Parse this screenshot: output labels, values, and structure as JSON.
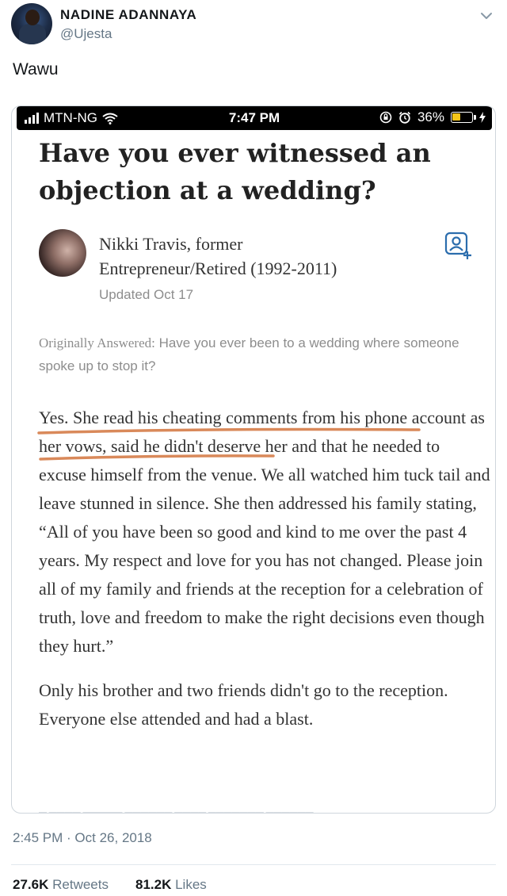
{
  "tweet": {
    "display_name": "NADINE ADANNAYA",
    "handle": "@Ujesta",
    "text": "Wawu",
    "timestamp": "2:45 PM · Oct 26, 2018",
    "retweets_count": "27.6K",
    "retweets_label": "Retweets",
    "likes_count": "81.2K",
    "likes_label": "Likes"
  },
  "screenshot": {
    "statusbar": {
      "carrier": "MTN-NG",
      "time": "7:47 PM",
      "battery": "36%"
    },
    "question_title": "Have you ever witnessed an objection at a wedding?",
    "author": {
      "line1": "Nikki Travis, former",
      "line2": "Entrepreneur/Retired (1992-2011)",
      "updated": "Updated Oct 17"
    },
    "originally_label": "Originally Answered:",
    "originally_question": "Have you ever been to a wedding where someone spoke up to stop it?",
    "answer_paragraph_1": "Yes. She read his cheating comments from his phone account as her vows, said he didn't deserve her and that he needed to excuse himself from the venue. We all watched him tuck tail and leave stunned in silence. She then addressed his family stating, “All of you have been so good and kind to me over the past 4 years. My respect and love for you has not changed. Please join all of my family and friends at the reception for a celebration of truth, love and freedom to make the right decisions even though they hurt.”",
    "answer_paragraph_2": "Only his brother and two friends didn't go to the reception. Everyone else attended and had a blast."
  },
  "colors": {
    "underline": "#d9895a",
    "link_blue": "#2b6dad"
  },
  "icons": [
    "chevron-down-icon",
    "signal-icon",
    "wifi-icon",
    "rotation-lock-icon",
    "alarm-icon",
    "battery-icon",
    "follow-person-icon"
  ]
}
